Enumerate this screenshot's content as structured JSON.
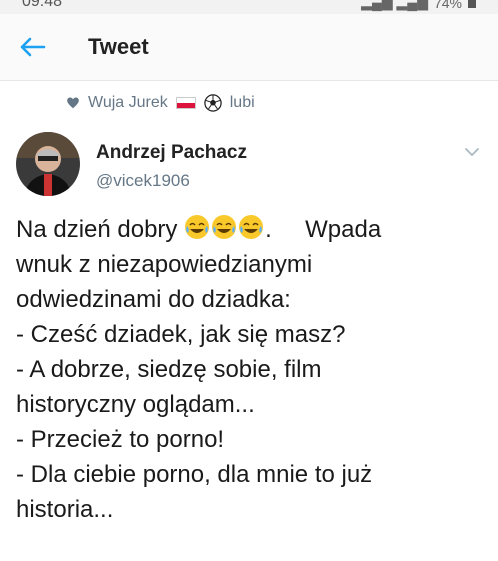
{
  "status_bar": {
    "time": "09:48",
    "battery": "74%"
  },
  "header": {
    "title": "Tweet",
    "back_icon": "arrow-left-icon"
  },
  "social_context": {
    "user": "Wuja Jurek",
    "action": "lubi",
    "icons": [
      "heart-icon",
      "poland-flag-icon",
      "soccer-ball-icon"
    ]
  },
  "tweet": {
    "author_name": "Andrzej Pachacz",
    "handle": "@vicek1906",
    "emoji_icon": "face-tears-of-joy-icon",
    "lines": [
      "Na dzień dobry",
      ".     Wpada",
      "wnuk z niezapowiedzianymi",
      "odwiedzinami do dziadka:",
      "- Cześć dziadek, jak się masz?",
      "- A dobrze, siedzę sobie, film",
      "historyczny oglądam...",
      "- Przecież to porno!",
      "- Dla ciebie porno, dla mnie to już",
      "historia..."
    ]
  },
  "colors": {
    "accent": "#1da1f2",
    "muted": "#657786",
    "text": "#1a1a1a"
  }
}
